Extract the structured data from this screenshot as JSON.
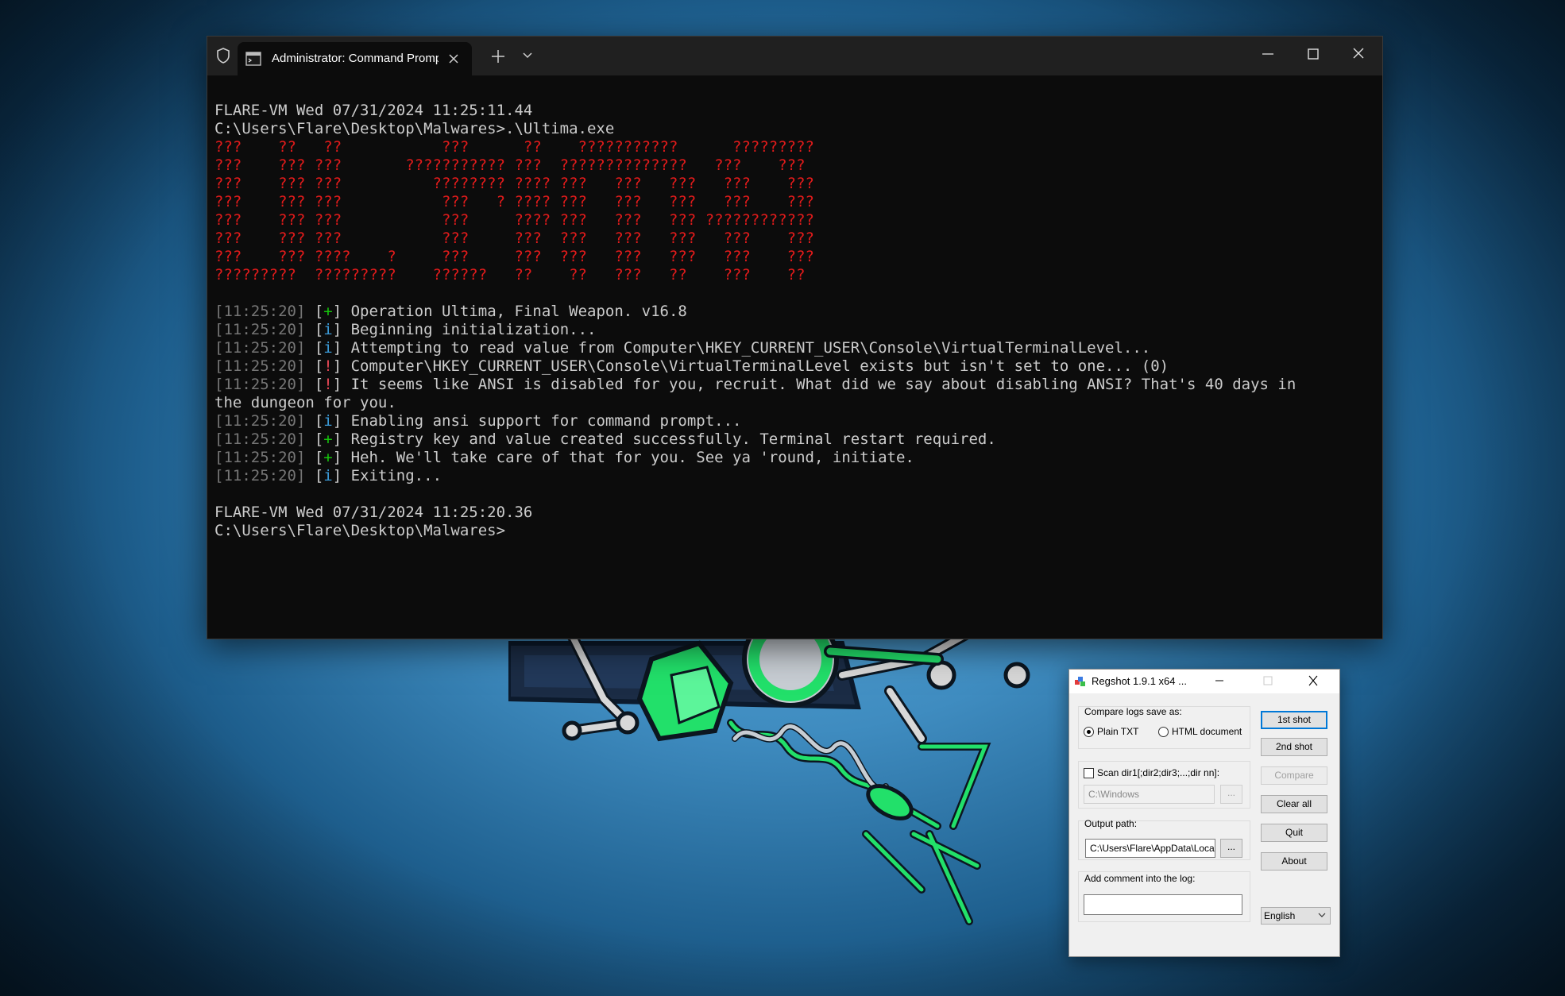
{
  "terminal": {
    "tab_title": "Administrator: Command Prompt",
    "lines": [
      {
        "parts": [
          {
            "text": "FLARE-VM Wed 07/31/2024 11:25:11.44",
            "cls": ""
          }
        ]
      },
      {
        "parts": [
          {
            "text": "C:\\Users\\Flare\\Desktop\\Malwares>.\\Ultima.exe",
            "cls": ""
          }
        ]
      },
      {
        "parts": [
          {
            "text": "???    ??   ??           ???      ??    ???????????      ?????????",
            "cls": "art"
          }
        ]
      },
      {
        "parts": [
          {
            "text": "???    ??? ???       ??????????? ???  ??????????????   ???    ???",
            "cls": "art"
          }
        ]
      },
      {
        "parts": [
          {
            "text": "???    ??? ???          ???????? ???? ???   ???   ???   ???    ???",
            "cls": "art"
          }
        ]
      },
      {
        "parts": [
          {
            "text": "???    ??? ???           ???   ? ???? ???   ???   ???   ???    ???",
            "cls": "art"
          }
        ]
      },
      {
        "parts": [
          {
            "text": "???    ??? ???           ???     ???? ???   ???   ??? ????????????",
            "cls": "art"
          }
        ]
      },
      {
        "parts": [
          {
            "text": "???    ??? ???           ???     ???  ???   ???   ???   ???    ???",
            "cls": "art"
          }
        ]
      },
      {
        "parts": [
          {
            "text": "???    ??? ????    ?     ???     ???  ???   ???   ???   ???    ???",
            "cls": "art"
          }
        ]
      },
      {
        "parts": [
          {
            "text": "?????????  ?????????    ??????   ??    ??   ???   ??    ???    ??",
            "cls": "art"
          }
        ]
      },
      {
        "parts": []
      },
      {
        "parts": [
          {
            "text": "[11:25:20]",
            "cls": "ts"
          },
          {
            "text": " [",
            "cls": "br"
          },
          {
            "text": "+",
            "cls": "tag-plus"
          },
          {
            "text": "] Operation Ultima, Final Weapon. v16.8",
            "cls": ""
          }
        ]
      },
      {
        "parts": [
          {
            "text": "[11:25:20]",
            "cls": "ts"
          },
          {
            "text": " [",
            "cls": "br"
          },
          {
            "text": "i",
            "cls": "tag-info"
          },
          {
            "text": "] Beginning initialization...",
            "cls": ""
          }
        ]
      },
      {
        "parts": [
          {
            "text": "[11:25:20]",
            "cls": "ts"
          },
          {
            "text": " [",
            "cls": "br"
          },
          {
            "text": "i",
            "cls": "tag-info"
          },
          {
            "text": "] Attempting to read value from Computer\\HKEY_CURRENT_USER\\Console\\VirtualTerminalLevel...",
            "cls": ""
          }
        ]
      },
      {
        "parts": [
          {
            "text": "[11:25:20]",
            "cls": "ts"
          },
          {
            "text": " [",
            "cls": "br"
          },
          {
            "text": "!",
            "cls": "tag-warn"
          },
          {
            "text": "] Computer\\HKEY_CURRENT_USER\\Console\\VirtualTerminalLevel exists but isn't set to one... (0)",
            "cls": ""
          }
        ]
      },
      {
        "parts": [
          {
            "text": "[11:25:20]",
            "cls": "ts"
          },
          {
            "text": " [",
            "cls": "br"
          },
          {
            "text": "!",
            "cls": "tag-warn"
          },
          {
            "text": "] It seems like ANSI is disabled for you, recruit. What did we say about disabling ANSI? That's 40 days in",
            "cls": ""
          }
        ]
      },
      {
        "parts": [
          {
            "text": "the dungeon for you.",
            "cls": ""
          }
        ]
      },
      {
        "parts": [
          {
            "text": "[11:25:20]",
            "cls": "ts"
          },
          {
            "text": " [",
            "cls": "br"
          },
          {
            "text": "i",
            "cls": "tag-info"
          },
          {
            "text": "] Enabling ansi support for command prompt...",
            "cls": ""
          }
        ]
      },
      {
        "parts": [
          {
            "text": "[11:25:20]",
            "cls": "ts"
          },
          {
            "text": " [",
            "cls": "br"
          },
          {
            "text": "+",
            "cls": "tag-plus"
          },
          {
            "text": "] Registry key and value created successfully. Terminal restart required.",
            "cls": ""
          }
        ]
      },
      {
        "parts": [
          {
            "text": "[11:25:20]",
            "cls": "ts"
          },
          {
            "text": " [",
            "cls": "br"
          },
          {
            "text": "+",
            "cls": "tag-plus"
          },
          {
            "text": "] Heh. We'll take care of that for you. See ya 'round, initiate.",
            "cls": ""
          }
        ]
      },
      {
        "parts": [
          {
            "text": "[11:25:20]",
            "cls": "ts"
          },
          {
            "text": " [",
            "cls": "br"
          },
          {
            "text": "i",
            "cls": "tag-info"
          },
          {
            "text": "] Exiting...",
            "cls": ""
          }
        ]
      },
      {
        "parts": []
      },
      {
        "parts": [
          {
            "text": "FLARE-VM Wed 07/31/2024 11:25:20.36",
            "cls": ""
          }
        ]
      },
      {
        "parts": [
          {
            "text": "C:\\Users\\Flare\\Desktop\\Malwares>",
            "cls": ""
          }
        ]
      }
    ]
  },
  "regshot": {
    "title": "Regshot 1.9.1 x64 ...",
    "compare_label": "Compare logs save as:",
    "format_options": [
      {
        "label": "Plain TXT",
        "selected": true
      },
      {
        "label": "HTML document",
        "selected": false
      }
    ],
    "scan_dirs_label": "Scan dir1[;dir2;dir3;...;dir nn]:",
    "scan_dirs_checked": false,
    "scan_dirs_value": "C:\\Windows",
    "browse_label": "...",
    "output_path_label": "Output path:",
    "output_path_value": "C:\\Users\\Flare\\AppData\\Local\\Temp",
    "comment_label": "Add comment into the log:",
    "comment_value": "",
    "buttons": {
      "first_shot": "1st shot",
      "second_shot": "2nd shot",
      "compare": "Compare",
      "clear_all": "Clear all",
      "quit": "Quit",
      "about": "About"
    },
    "language": "English"
  },
  "colors": {
    "terminal_bg": "#0c0c0c",
    "terminal_fg": "#cccccc",
    "ascii_art": "#e31b1b",
    "timestamp": "#767676",
    "tag_plus": "#16c60c",
    "tag_info": "#3b9bd8",
    "tag_warn": "#e74856",
    "mascot_green": "#22e06a"
  }
}
